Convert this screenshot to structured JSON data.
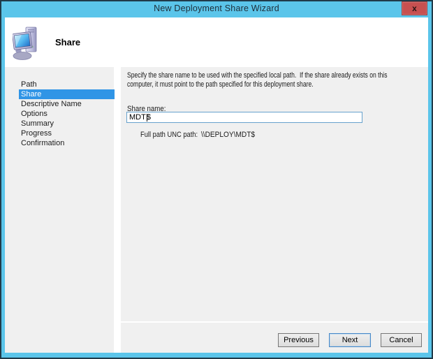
{
  "window": {
    "title": "New Deployment Share Wizard",
    "close_glyph": "x"
  },
  "header": {
    "title": "Share",
    "icon": "computer-icon"
  },
  "sidebar": {
    "items": [
      {
        "label": "Path",
        "selected": false
      },
      {
        "label": "Share",
        "selected": true
      },
      {
        "label": "Descriptive Name",
        "selected": false
      },
      {
        "label": "Options",
        "selected": false
      },
      {
        "label": "Summary",
        "selected": false
      },
      {
        "label": "Progress",
        "selected": false
      },
      {
        "label": "Confirmation",
        "selected": false
      }
    ]
  },
  "content": {
    "instruction_lines": [
      "Specify the share name to be used with the specified local path.  If the share already exists on this",
      "computer, it must point to the path specified for this deployment share."
    ],
    "share_name_label": "Share name:",
    "share_name_input": {
      "value": "MDT$",
      "text_before_caret": "MDT",
      "text_after_caret": "$"
    },
    "unc_path_label": "Full path UNC path:",
    "unc_path_value": "\\\\DEPLOY\\MDT$"
  },
  "footer": {
    "previous_label": "Previous",
    "next_label": "Next",
    "cancel_label": "Cancel"
  },
  "colors": {
    "titlebar_blue": "#5bc5ea",
    "window_outline": "#203a49",
    "selection_blue": "#3095e6",
    "close_button_red": "#c75050",
    "panel_gray": "#f0f0f0",
    "input_border_blue": "#66a1cc",
    "default_button_border": "#4788c8"
  }
}
